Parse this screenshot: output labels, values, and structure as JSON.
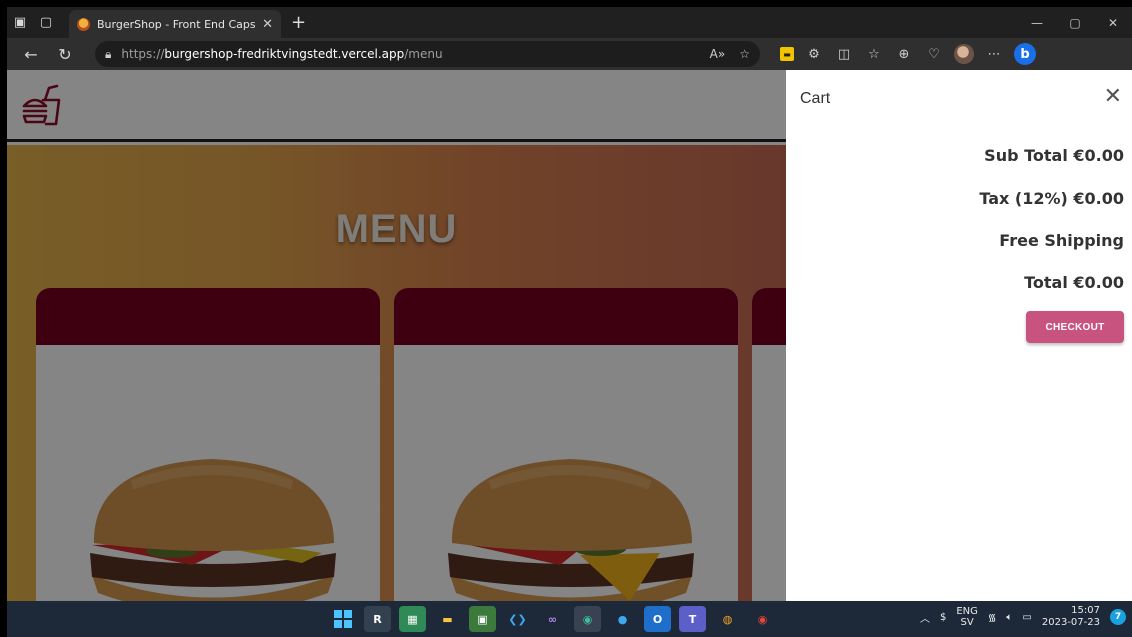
{
  "browser": {
    "tab": {
      "title": "BurgerShop - Front End Capston",
      "close": "✕"
    },
    "new_tab": "+",
    "window_controls": [
      "—",
      "▢",
      "✕"
    ],
    "address": {
      "scheme": "https://",
      "host": "burgershop-fredriktvingstedt.vercel.app",
      "path": "/menu"
    },
    "toolbar_icons": [
      "read-aloud-icon",
      "favorite-star-icon",
      "extension-icon",
      "extensions-puzzle-icon",
      "split-screen-icon",
      "favorites-icon",
      "collections-icon",
      "heart-icon",
      "profile-avatar",
      "more-icon",
      "bing-icon"
    ]
  },
  "page": {
    "menu_title": "MENU",
    "brand_color": "#770020",
    "hero_gradient": [
      "#e7b44b",
      "#c86a55"
    ]
  },
  "cart": {
    "title": "Cart",
    "close": "✕",
    "sub_total": "Sub Total €0.00",
    "tax": "Tax (12%) €0.00",
    "shipping": "Free Shipping",
    "total": "Total €0.00",
    "checkout_label": "CHECKOUT",
    "accent": "#c8537f"
  },
  "taskbar": {
    "lang_top": "ENG",
    "lang_bottom": "SV",
    "time": "15:07",
    "date": "2023-07-23",
    "notifications": "7"
  }
}
